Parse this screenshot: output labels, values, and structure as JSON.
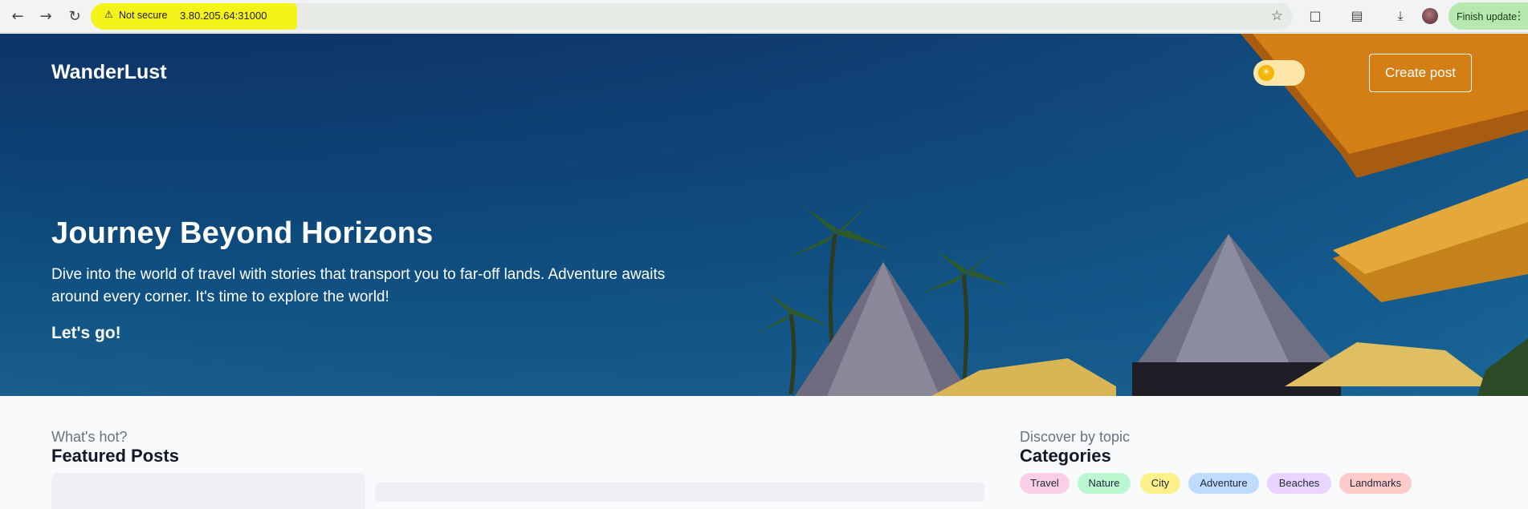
{
  "browser": {
    "not_secure": "Not secure",
    "url": "3.80.205.64:31000",
    "finish_update": "Finish update"
  },
  "header": {
    "logo": "WanderLust",
    "create_post": "Create post"
  },
  "hero": {
    "title": "Journey Beyond Horizons",
    "description": "Dive into the world of travel with stories that transport you to far-off lands. Adventure awaits around every corner. It's time to explore the world!",
    "cta": "Let's go!"
  },
  "featured": {
    "subtitle": "What's hot?",
    "title": "Featured Posts"
  },
  "categories": {
    "subtitle": "Discover by topic",
    "title": "Categories",
    "items": [
      {
        "label": "Travel",
        "color": "#fbcfe8"
      },
      {
        "label": "Nature",
        "color": "#bbf7d0"
      },
      {
        "label": "City",
        "color": "#fef08a"
      },
      {
        "label": "Adventure",
        "color": "#bfdbfe"
      },
      {
        "label": "Beaches",
        "color": "#e9d5ff"
      },
      {
        "label": "Landmarks",
        "color": "#fecaca"
      }
    ]
  },
  "icons": [
    "back-icon",
    "forward-icon",
    "reload-icon",
    "warning-icon",
    "star-icon",
    "extensions-icon",
    "reading-list-icon",
    "download-icon",
    "sun-icon",
    "more-icon"
  ]
}
